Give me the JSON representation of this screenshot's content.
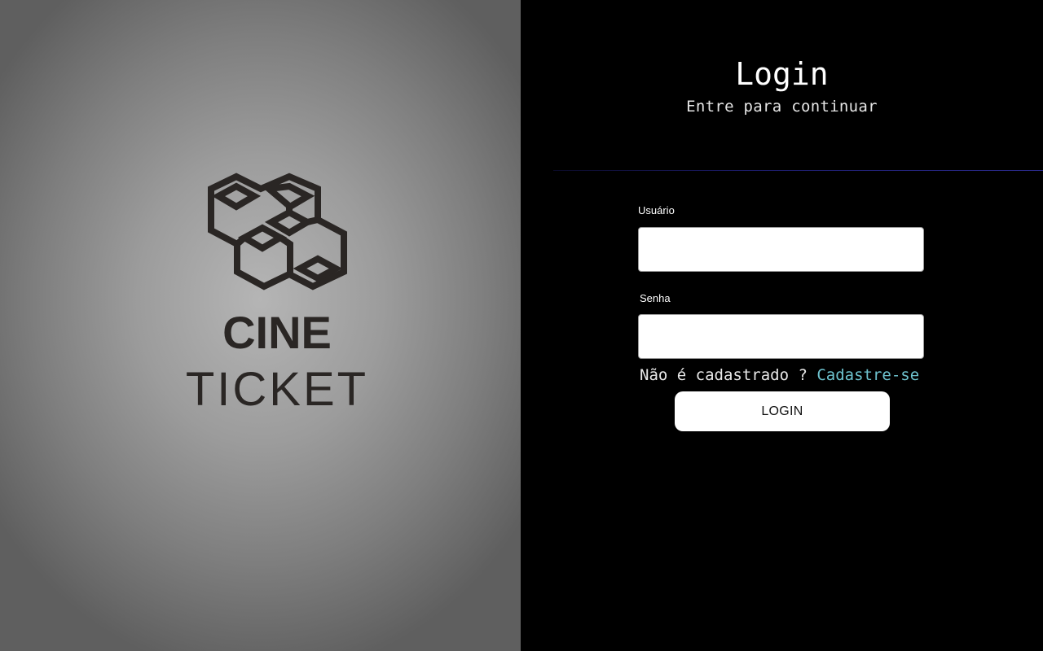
{
  "brand": {
    "line1": "CINE",
    "line2": "TICKET",
    "colors": {
      "mark": "#2a2624"
    }
  },
  "login": {
    "title": "Login",
    "subtitle": "Entre para continuar",
    "username_label": "Usuário",
    "username_value": "",
    "password_label": "Senha",
    "password_value": "",
    "register_prompt": "Não é cadastrado ? ",
    "register_link": "Cadastre-se",
    "submit_label": "LOGIN"
  },
  "colors": {
    "right_background": "#000000",
    "link": "#6ec3cf",
    "divider": "#2a2a8a",
    "button_background": "#ffffff"
  }
}
